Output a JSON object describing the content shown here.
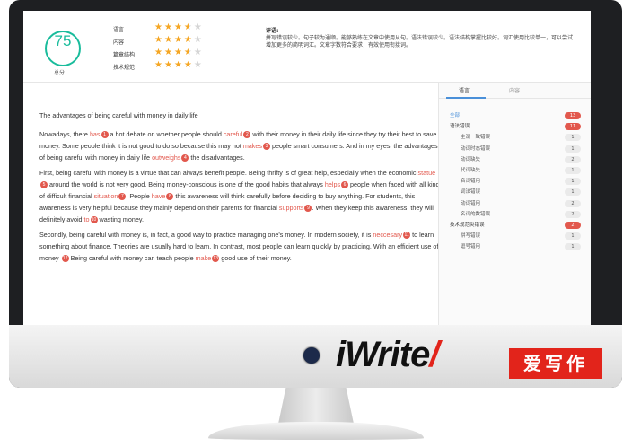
{
  "score": {
    "value": "75",
    "label": "总分"
  },
  "dimensions": [
    {
      "label": "语言",
      "rating": 3.5
    },
    {
      "label": "内容",
      "rating": 4
    },
    {
      "label": "篇章结构",
      "rating": 3.5
    },
    {
      "label": "技术规范",
      "rating": 4
    }
  ],
  "comment": {
    "title": "评语:",
    "text": "拼写错误较少。句子较为通顺。能够熟练在文章中使用从句。语法错误较少。语法结构掌握比较好。词汇使用比较单一，可以尝试增加更多的简明词汇。文章字数符合要求，有效使用衔接词。"
  },
  "essay": {
    "title": "The advantages of being careful with money in daily life",
    "paragraphs": [
      [
        {
          "t": "Nowadays, there "
        },
        {
          "e": "has",
          "n": "1"
        },
        {
          "t": " a hot debate on whether people should "
        },
        {
          "e": "careful",
          "n": "2"
        },
        {
          "t": " with their money in their daily life since they try their best to save money. Some people think it is not good to do so because this may not "
        },
        {
          "e": "makes",
          "n": "3"
        },
        {
          "t": " people smart consumers. And in my eyes, the advantages of being careful with money in daily life "
        },
        {
          "e": "outweighs",
          "n": "4"
        },
        {
          "t": " the disadvantages."
        }
      ],
      [
        {
          "t": "First, being careful with money is a virtue that can always benefit people. Being thrifty is of great help, especially when the economic "
        },
        {
          "e": "statue",
          "n": "5"
        },
        {
          "t": " around the world is not very good. Being money-conscious is one of the good habits that always "
        },
        {
          "e": "helps",
          "n": "6"
        },
        {
          "t": " people when faced with all kinds of difficult financial "
        },
        {
          "e": "situation",
          "n": "7"
        },
        {
          "t": ". People "
        },
        {
          "e": "have",
          "n": "8"
        },
        {
          "t": " this awareness will think carefully before deciding to buy anything. For students, this awareness is very helpful because they mainly depend on their parents for financial "
        },
        {
          "e": "supports",
          "n": "9"
        },
        {
          "t": ". When they keep this awareness, they will definitely avoid "
        },
        {
          "e": "to",
          "n": "10"
        },
        {
          "t": " wasting money."
        }
      ],
      [
        {
          "t": "Secondly, being careful with money is, in fact, a good way to practice managing one's money. In modern society, it is "
        },
        {
          "e": "neccesary",
          "n": "11"
        },
        {
          "t": " to learn something about finance. Theories are usually hard to learn. In contrast, most people can learn quickly by practicing. With an efficient use of money "
        },
        {
          "b": "12"
        },
        {
          "t": " Being careful with money can teach people "
        },
        {
          "e": "make",
          "n": "13"
        },
        {
          "t": " good use of their money."
        }
      ]
    ]
  },
  "sidebar": {
    "tabs": [
      "语言",
      "内容"
    ],
    "rows": [
      {
        "label": "全部",
        "count": "13",
        "kind": "all",
        "red": true
      },
      {
        "label": "语法错误",
        "count": "11",
        "kind": "head",
        "red": true
      },
      {
        "label": "主谓一致错误",
        "count": "1",
        "kind": "sub"
      },
      {
        "label": "动词时态错误",
        "count": "1",
        "kind": "sub"
      },
      {
        "label": "动词缺失",
        "count": "2",
        "kind": "sub"
      },
      {
        "label": "代词缺失",
        "count": "1",
        "kind": "sub"
      },
      {
        "label": "名词错用",
        "count": "1",
        "kind": "sub"
      },
      {
        "label": "词法错误",
        "count": "1",
        "kind": "sub"
      },
      {
        "label": "动词错用",
        "count": "2",
        "kind": "sub"
      },
      {
        "label": "名词的数错误",
        "count": "2",
        "kind": "sub"
      },
      {
        "label": "技术规范类错误",
        "count": "2",
        "kind": "head",
        "red": true
      },
      {
        "label": "拼写错误",
        "count": "1",
        "kind": "sub"
      },
      {
        "label": "逗号错用",
        "count": "1",
        "kind": "sub"
      }
    ]
  },
  "brand": {
    "name": "iWrite",
    "cn": "爱写作"
  },
  "colors": {
    "accent": "#1abc9c",
    "error": "#e2584d",
    "star": "#f5a623",
    "brand_red": "#e2241b"
  }
}
